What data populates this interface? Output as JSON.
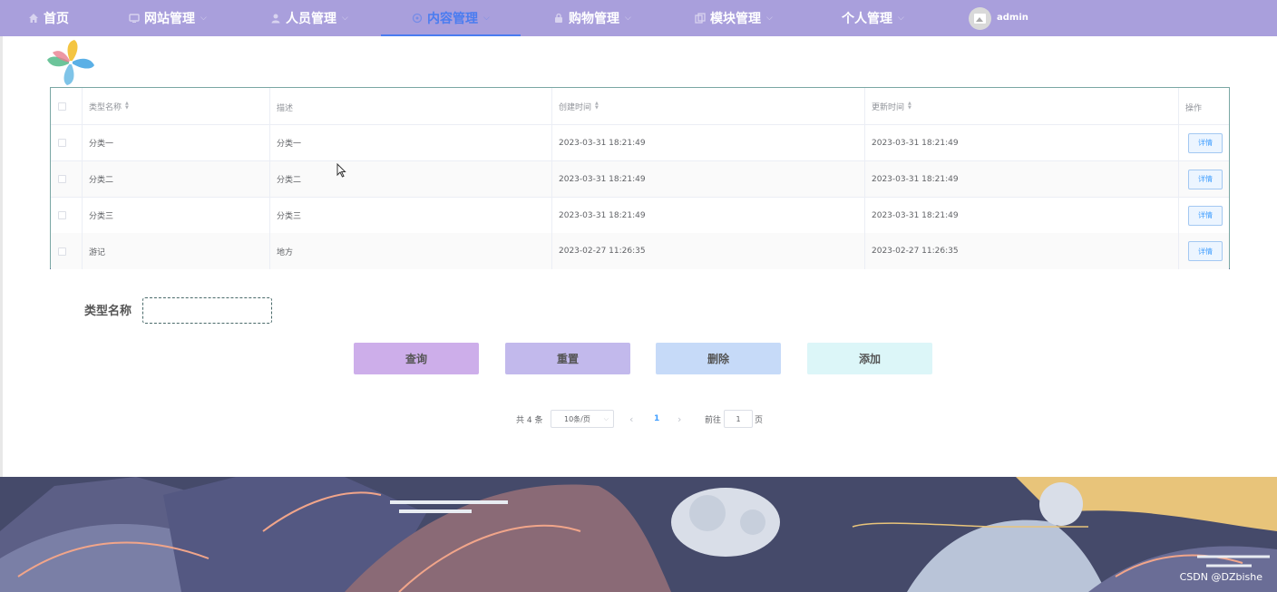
{
  "nav": {
    "items": [
      {
        "label": "首页",
        "icon": "home-icon"
      },
      {
        "label": "网站管理",
        "icon": "monitor-icon"
      },
      {
        "label": "人员管理",
        "icon": "user-icon"
      },
      {
        "label": "内容管理",
        "icon": "content-icon"
      },
      {
        "label": "购物管理",
        "icon": "lock-icon"
      },
      {
        "label": "模块管理",
        "icon": "copy-icon"
      },
      {
        "label": "个人管理",
        "icon": "person-icon"
      }
    ],
    "active_index": 3,
    "user": "admin",
    "bg_color": "#a99fdc",
    "active_color": "#4a7cf0"
  },
  "table": {
    "columns": [
      "类型名称",
      "描述",
      "创建时间",
      "更新时间",
      "操作"
    ],
    "rows": [
      {
        "name": "分类一",
        "desc": "分类一",
        "created": "2023-03-31 18:21:49",
        "updated": "2023-03-31 18:21:49",
        "action": "详情"
      },
      {
        "name": "分类二",
        "desc": "分类二",
        "created": "2023-03-31 18:21:49",
        "updated": "2023-03-31 18:21:49",
        "action": "详情"
      },
      {
        "name": "分类三",
        "desc": "分类三",
        "created": "2023-03-31 18:21:49",
        "updated": "2023-03-31 18:21:49",
        "action": "详情"
      },
      {
        "name": "游记",
        "desc": "地方",
        "created": "2023-02-27 11:26:35",
        "updated": "2023-02-27 11:26:35",
        "action": "详情"
      }
    ]
  },
  "search": {
    "label": "类型名称",
    "value": "",
    "placeholder": ""
  },
  "buttons": {
    "query": {
      "label": "查询",
      "color": "#cdaeea"
    },
    "reset": {
      "label": "重置",
      "color": "#c2b9ec"
    },
    "delete": {
      "label": "删除",
      "color": "#c6daf8"
    },
    "add": {
      "label": "添加",
      "color": "#dcf6f8"
    }
  },
  "pagination": {
    "total": "共 4 条",
    "page_size": "10条/页",
    "current_page": "1",
    "goto_prefix": "前往",
    "goto_value": "1",
    "goto_suffix": "页",
    "prev": "‹",
    "next": "›"
  },
  "watermark": "CSDN @DZbishe"
}
